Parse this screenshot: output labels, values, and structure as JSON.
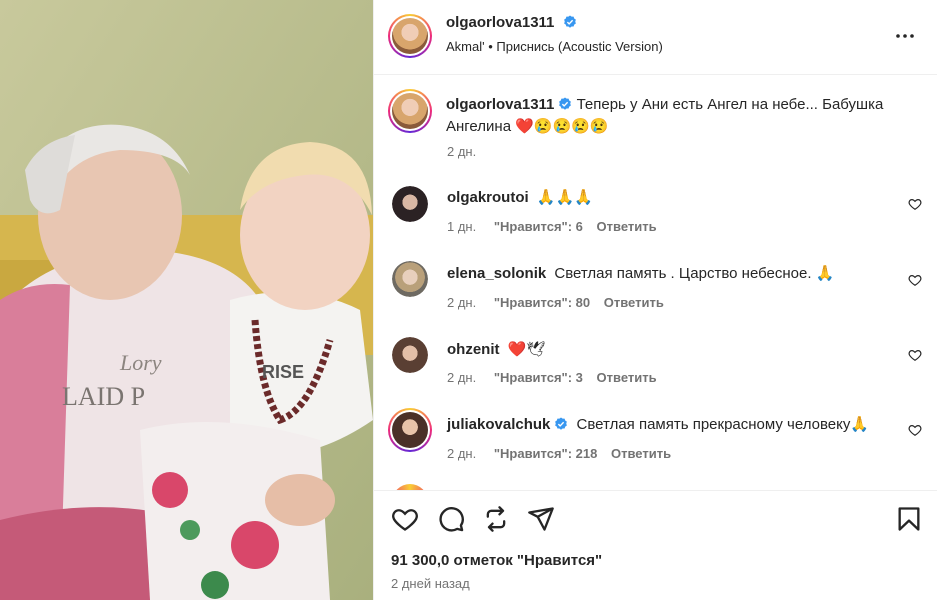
{
  "post": {
    "author": "olgaorlova1311",
    "audio": "Akmal' • Приснись (Acoustic Version)",
    "caption": "Теперь у Ани есть Ангел на небе... Бабушка Ангелина ❤️😢😢😢😢",
    "caption_line1": "Теперь у Ани есть Ангел на небе... Бабушка",
    "caption_line2": "Ангелина",
    "caption_time": "2 дн.",
    "likes": "91 300,0 отметок \"Нравится\"",
    "date": "2 дней назад"
  },
  "comments": [
    {
      "user": "olgakroutoi",
      "text": "🙏🙏🙏",
      "verified": false,
      "time": "1 дн.",
      "likes": "\"Нравится\": 6",
      "reply": "Ответить"
    },
    {
      "user": "elena_solonik",
      "text": "Светлая память . Царство небесное. 🙏",
      "verified": false,
      "time": "2 дн.",
      "likes": "\"Нравится\": 80",
      "reply": "Ответить"
    },
    {
      "user": "ohzenit",
      "text": "❤️🕊",
      "verified": false,
      "time": "2 дн.",
      "likes": "\"Нравится\": 3",
      "reply": "Ответить"
    },
    {
      "user": "juliakovalchuk",
      "text": "Светлая память прекрасному человеку🙏",
      "verified": true,
      "time": "2 дн.",
      "likes": "\"Нравится\": 218",
      "reply": "Ответить"
    }
  ],
  "icons": {
    "verified_color": "#3897f0",
    "actions": [
      "heart-icon",
      "comment-icon",
      "repost-icon",
      "share-icon",
      "bookmark-icon"
    ]
  },
  "media": {
    "printed_text": [
      "Lory",
      "LAID P",
      "RISE"
    ]
  }
}
